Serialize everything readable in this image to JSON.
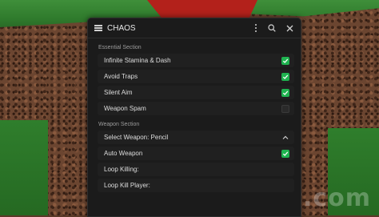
{
  "window": {
    "title": "CHAOS"
  },
  "sections": [
    {
      "label": "Essential Section",
      "items": [
        {
          "label": "Infinite Stamina & Dash",
          "checked": true
        },
        {
          "label": "Avoid Traps",
          "checked": true
        },
        {
          "label": "Silent Aim",
          "checked": true
        },
        {
          "label": "Weapon Spam",
          "checked": false
        }
      ]
    },
    {
      "label": "Weapon Section",
      "dropdown": {
        "label": "Select Weapon: Pencil"
      },
      "items": [
        {
          "label": "Auto Weapon",
          "checked": true
        }
      ],
      "extra": [
        {
          "label": "Loop Killing:"
        },
        {
          "label": "Loop Kill Player:"
        }
      ]
    }
  ],
  "watermark": "rbxscript.com",
  "colors": {
    "accent": "#1fb350",
    "panel": "#1b1b1b",
    "row": "#202020"
  },
  "icons": [
    "menu-icon",
    "more-vertical-icon",
    "search-icon",
    "close-icon",
    "checkmark-icon",
    "chevron-up-icon"
  ]
}
